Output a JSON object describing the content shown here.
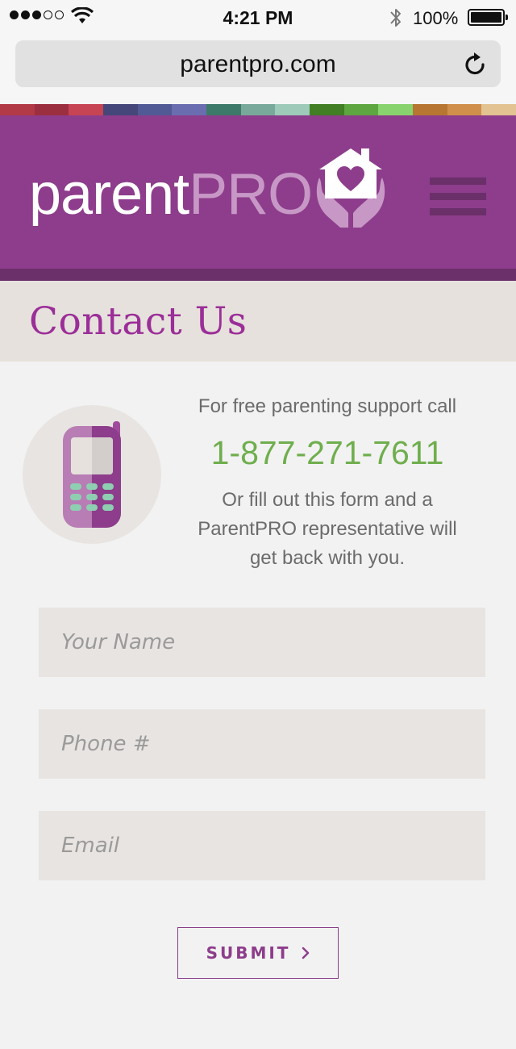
{
  "status_bar": {
    "time": "4:21 PM",
    "battery_percent": "100%",
    "signal_bars_filled": 3,
    "signal_bars_total": 5
  },
  "browser": {
    "url": "parentpro.com"
  },
  "header": {
    "logo_parent": "parent",
    "logo_pro": "PRO",
    "stripe_colors": [
      "#b13a46",
      "#9c2f3f",
      "#c64454",
      "#45477a",
      "#525a95",
      "#6a6db0",
      "#3e7a69",
      "#79a99b",
      "#9dcab9",
      "#417e24",
      "#5da640",
      "#88d36e",
      "#b77631",
      "#d08f4a",
      "#e2c391"
    ]
  },
  "page": {
    "title": "Contact Us"
  },
  "intro": {
    "line1": "For free parenting support call",
    "phone": "1-877-271-7611",
    "line2": "Or fill out this form and a ParentPRO representative will get back with you."
  },
  "form": {
    "name_placeholder": "Your Name",
    "phone_placeholder": "Phone #",
    "email_placeholder": "Email",
    "submit_label": "SUBMIT"
  },
  "icons": {
    "menu": "hamburger-menu-icon",
    "reload": "reload-icon",
    "phone": "cell-phone-icon",
    "logo_mark": "house-heart-hands-icon",
    "chevron": "chevron-right-icon"
  }
}
